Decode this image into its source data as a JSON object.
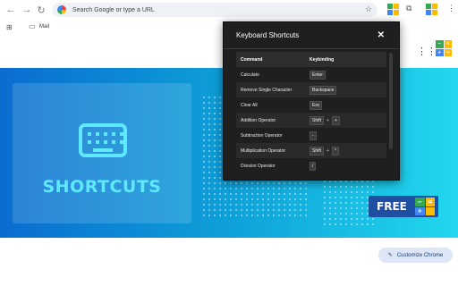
{
  "browser": {
    "search_placeholder": "Search Google or type a URL",
    "bookmarks": [
      {
        "label": "Mail"
      }
    ],
    "icons": [
      "back-arrow-icon",
      "forward-arrow-icon",
      "reload-icon",
      "google-icon",
      "star-icon",
      "puzzle-icon",
      "apps-icon",
      "folder-icon"
    ]
  },
  "banner": {
    "title": "SHORTCUTS",
    "free_label": "FREE",
    "calc_symbols": [
      "−",
      "×",
      "+",
      "="
    ]
  },
  "customize": {
    "label": "Customize Chrome"
  },
  "popup": {
    "title": "Keyboard Shortcuts",
    "close": "✕",
    "header": {
      "command": "Command",
      "keybinding": "Keybinding"
    },
    "rows": [
      {
        "command": "Calculate",
        "keys": [
          "Enter"
        ]
      },
      {
        "command": "Remove Single Character",
        "keys": [
          "Backspace"
        ]
      },
      {
        "command": "Clear All",
        "keys": [
          "Esc"
        ]
      },
      {
        "command": "Addition Operator",
        "keys": [
          "Shift",
          "+"
        ]
      },
      {
        "command": "Subtraction Operator",
        "keys": [
          "-"
        ]
      },
      {
        "command": "Multiplication Operator",
        "keys": [
          "Shift",
          "*"
        ]
      },
      {
        "command": "Division Operator",
        "keys": [
          "/"
        ]
      }
    ]
  },
  "colors": {
    "banner_start": "#0a6dd0",
    "banner_end": "#22d8ee",
    "accent_cyan": "#5ee9ff",
    "calc_green": "#34a853",
    "calc_blue": "#4285f4",
    "calc_yellow": "#fbbc05"
  }
}
